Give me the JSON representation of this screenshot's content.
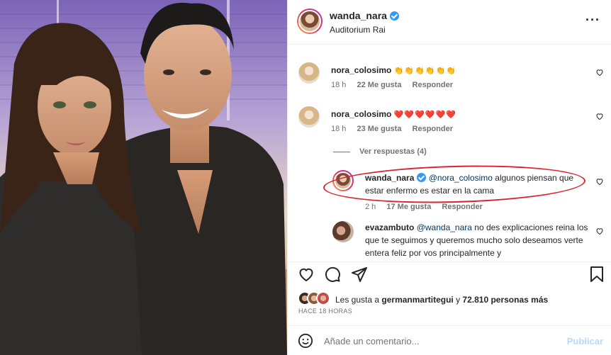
{
  "post": {
    "username": "wanda_nara",
    "location": "Auditorium Rai",
    "more_icon": "ellipsis-icon"
  },
  "comments": [
    {
      "username": "nora_colosimo",
      "text": "👏👏👏👏👏👏",
      "time": "18 h",
      "likes": "22 Me gusta",
      "reply": "Responder"
    },
    {
      "username": "nora_colosimo",
      "text": "❤️❤️❤️❤️❤️❤️",
      "time": "18 h",
      "likes": "23 Me gusta",
      "reply": "Responder",
      "view_replies": "Ver respuestas (4)"
    }
  ],
  "reply_comment": {
    "username": "wanda_nara",
    "mention": "@nora_colosimo",
    "text": " algunos piensan que estar enfermo es estar en la cama",
    "time": "2 h",
    "likes": "17 Me gusta",
    "reply": "Responder"
  },
  "last_comment": {
    "username": "evazambuto",
    "mention": "@wanda_nara",
    "text": " no des explicaciones reina los que te seguimos y queremos mucho solo deseamos verte entera feliz por vos principalmente y"
  },
  "likes": {
    "prefix": "Les gusta a ",
    "user": "germanmartitegui",
    "middle": " y ",
    "count": "72.810 personas más"
  },
  "posted_ago": "HACE 18 HORAS",
  "add_comment": {
    "placeholder": "Añade un comentario...",
    "publish": "Publicar"
  },
  "colors": {
    "accent": "#3897f0",
    "highlight_oval": "#d9232e",
    "publish_disabled": "#b3dbff"
  }
}
